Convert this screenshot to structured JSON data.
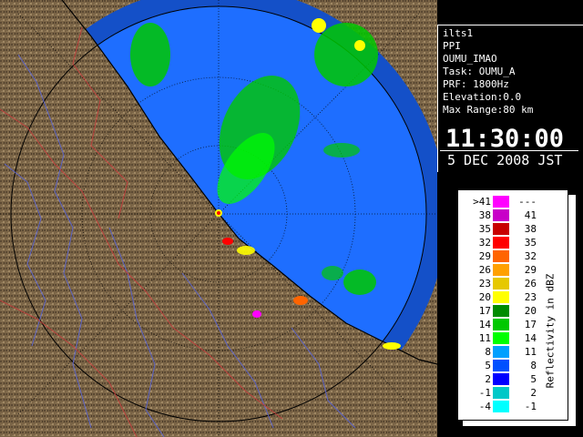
{
  "info": {
    "lines": [
      "ilts1",
      "PPI",
      "OUMU_IMAO",
      "Task: OUMU_A",
      "PRF: 1800Hz",
      "Elevation:0.0",
      "Max Range:80 km"
    ],
    "time": "11:30:00",
    "date": "5 DEC 2008 JST"
  },
  "legend": {
    "title": "Reflectivity in dBZ",
    "rows": [
      {
        "lo": ">41",
        "hi": "---",
        "color": "#ff00ff"
      },
      {
        "lo": "38",
        "hi": "41",
        "color": "#c800c8"
      },
      {
        "lo": "35",
        "hi": "38",
        "color": "#c80000"
      },
      {
        "lo": "32",
        "hi": "35",
        "color": "#ff0000"
      },
      {
        "lo": "29",
        "hi": "32",
        "color": "#ff6400"
      },
      {
        "lo": "26",
        "hi": "29",
        "color": "#ffa000"
      },
      {
        "lo": "23",
        "hi": "26",
        "color": "#e6c800"
      },
      {
        "lo": "20",
        "hi": "23",
        "color": "#ffff00"
      },
      {
        "lo": "17",
        "hi": "20",
        "color": "#008c00"
      },
      {
        "lo": "14",
        "hi": "17",
        "color": "#00c800"
      },
      {
        "lo": "11",
        "hi": "14",
        "color": "#00ff00"
      },
      {
        "lo": "8",
        "hi": "11",
        "color": "#00a0ff"
      },
      {
        "lo": "5",
        "hi": "8",
        "color": "#0050ff"
      },
      {
        "lo": "2",
        "hi": "5",
        "color": "#0000ff"
      },
      {
        "lo": "-1",
        "hi": "2",
        "color": "#00c8c8"
      },
      {
        "lo": "-4",
        "hi": "-1",
        "color": "#00ffff"
      }
    ]
  },
  "map": {
    "land_color": "#7a6446",
    "sea_color": "#1e6eff",
    "outer_band_color": "#1450c8",
    "ring_color": "#000000"
  }
}
